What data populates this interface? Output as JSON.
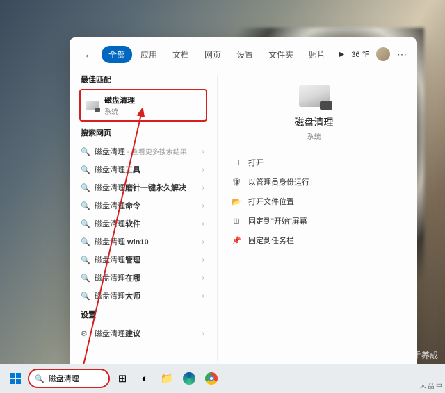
{
  "header": {
    "tabs": [
      "全部",
      "应用",
      "文档",
      "网页",
      "设置",
      "文件夹",
      "照片"
    ],
    "active_tab": 0,
    "weather": "36 ℉"
  },
  "left": {
    "best_match_label": "最佳匹配",
    "best_match": {
      "title": "磁盘清理",
      "sub": "系统"
    },
    "web_label": "搜索网页",
    "settings_label": "设置",
    "web_items": [
      {
        "prefix": "磁盘清理",
        "bold": "",
        "hint": " - 查看更多搜索结果"
      },
      {
        "prefix": "磁盘清理",
        "bold": "工具",
        "hint": ""
      },
      {
        "prefix": "磁盘清理",
        "bold": "磨针一键永久解决",
        "hint": ""
      },
      {
        "prefix": "磁盘清理",
        "bold": "命令",
        "hint": ""
      },
      {
        "prefix": "磁盘清理",
        "bold": "软件",
        "hint": ""
      },
      {
        "prefix": "磁盘清理",
        "bold": " win10",
        "hint": ""
      },
      {
        "prefix": "磁盘清理",
        "bold": "管理",
        "hint": ""
      },
      {
        "prefix": "磁盘清理",
        "bold": "在哪",
        "hint": ""
      },
      {
        "prefix": "磁盘清理",
        "bold": "大师",
        "hint": ""
      }
    ],
    "settings_item": {
      "prefix": "磁盘清理",
      "bold": "建议"
    }
  },
  "right": {
    "title": "磁盘清理",
    "sub": "系统",
    "actions": [
      {
        "icon": "open",
        "label": "打开"
      },
      {
        "icon": "admin",
        "label": "以管理员身份运行"
      },
      {
        "icon": "folder",
        "label": "打开文件位置"
      },
      {
        "icon": "pin-start",
        "label": "固定到\"开始\"屏幕"
      },
      {
        "icon": "pin-task",
        "label": "固定到任务栏"
      }
    ]
  },
  "taskbar": {
    "search_value": "磁盘清理"
  },
  "watermark": "@python高手养成",
  "corner": "人 品 中"
}
